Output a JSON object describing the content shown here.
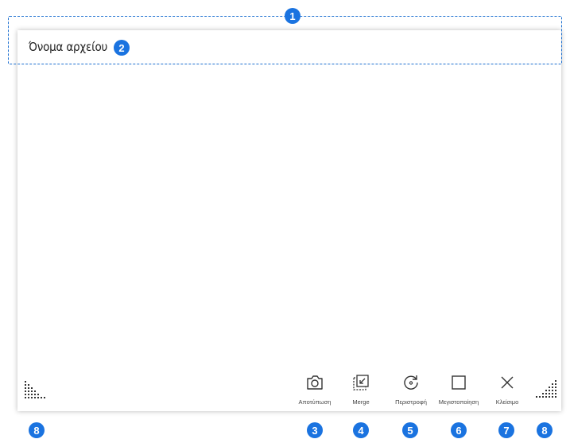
{
  "window": {
    "file_name": "Όνομα αρχείου"
  },
  "callouts": {
    "title_bar": "1",
    "file_name": "2",
    "capture": "3",
    "merge": "4",
    "rotate": "5",
    "maximize": "6",
    "close": "7",
    "resize_left": "8",
    "resize_right": "8"
  },
  "toolbar": {
    "capture_label": "Αποτύπωση",
    "merge_label": "Merge",
    "rotate_label": "Περιστροφή",
    "maximize_label": "Μεγιστοποίηση",
    "close_label": "Κλείσιμο"
  },
  "icons": {
    "capture": "camera-icon",
    "merge": "merge-icon",
    "rotate": "rotate-icon",
    "maximize": "maximize-icon",
    "close": "close-icon",
    "resize": "resize-handle-icon"
  },
  "colors": {
    "callout": "#1a73e0",
    "outline": "#1c6fd0"
  }
}
